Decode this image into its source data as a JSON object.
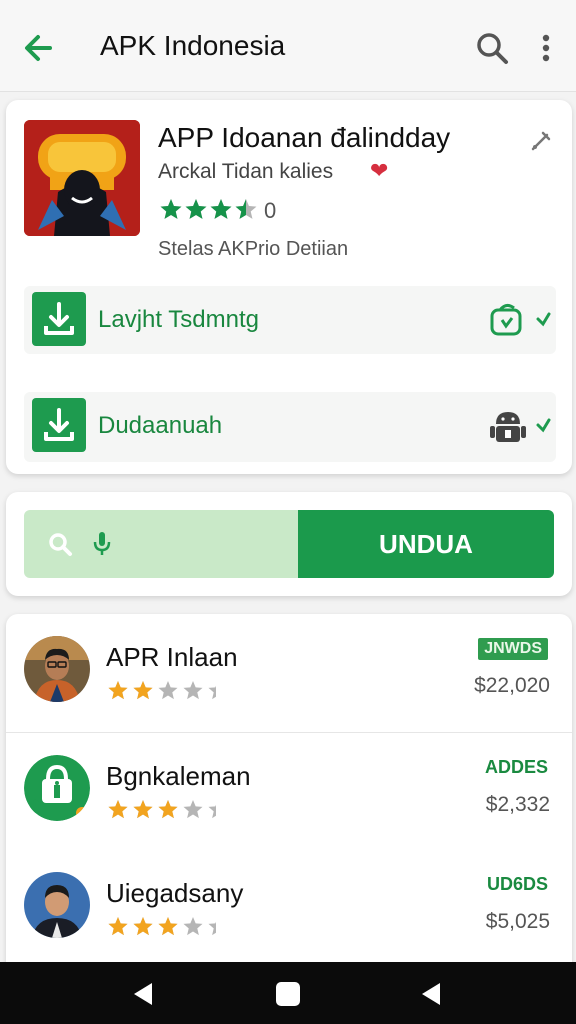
{
  "appbar": {
    "title": "APK Indonesia",
    "back_icon": "arrow-left-icon",
    "search_icon": "search-icon",
    "more_icon": "more-vert-icon"
  },
  "app": {
    "name": "APP Idoanan đalindday",
    "subtitle": "Arckal Tidan kalies",
    "rating_count": "0",
    "rating": 3.5,
    "meta": "Stelas AKPrio Detiian"
  },
  "downloads": [
    {
      "label": "Lavjht Tsdmntg",
      "right_icon": "sync-icon"
    },
    {
      "label": "Dudaanuah",
      "right_icon": "android-icon"
    }
  ],
  "searchbar": {
    "button_label": "UNDUA"
  },
  "list": [
    {
      "name": "APR Inlaan",
      "badge": "JNWDS",
      "price": "$22,020",
      "rating": 2
    },
    {
      "name": "Bgnkaleman",
      "badge": "ADDES",
      "price": "$2,332",
      "rating": 3
    },
    {
      "name": "Uiegadsany",
      "badge": "UD6DS",
      "price": "$5,025",
      "rating": 3
    }
  ],
  "colors": {
    "primary_green": "#1e9b4f",
    "light_green": "#c9e9c8",
    "star_green": "#16934a",
    "star_orange": "#f2a41f",
    "heart": "#d62f3f"
  }
}
